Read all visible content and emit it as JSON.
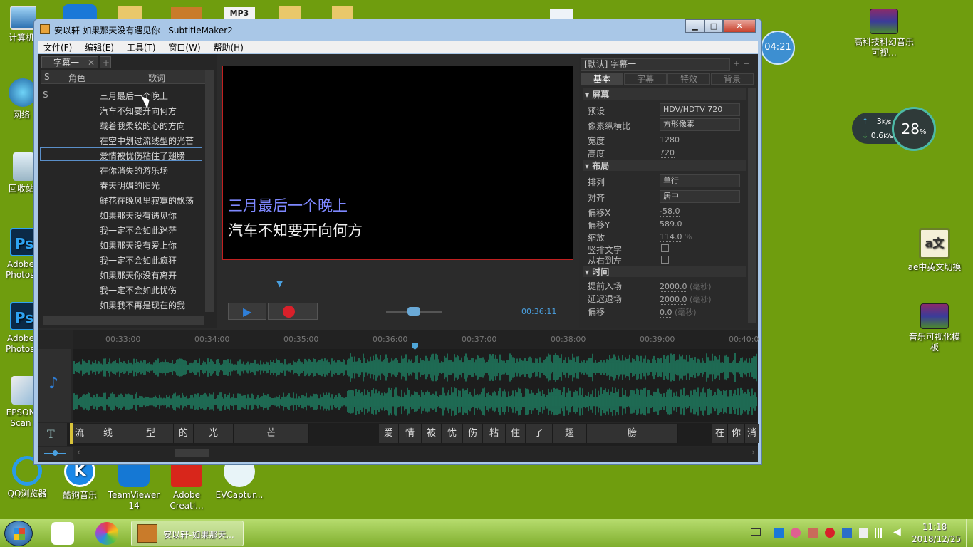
{
  "desktop": {
    "icons": [
      {
        "label": "计算机"
      },
      {
        "label": "网络"
      },
      {
        "label": "回收站"
      },
      {
        "label": "Adobe Photoshop"
      },
      {
        "label": "Adobe Photoshop"
      },
      {
        "label": "EPSON Scan"
      },
      {
        "label": "QQ浏览器"
      },
      {
        "label": "酷狗音乐"
      },
      {
        "label": "TeamViewer 14"
      },
      {
        "label": "Adobe Creati..."
      },
      {
        "label": "EVCaptur..."
      },
      {
        "label": "高科技科幻音乐可视..."
      },
      {
        "label": "ae中英文切换"
      },
      {
        "label": "音乐可视化模板"
      }
    ],
    "top_badge": "MP3"
  },
  "widgets": {
    "clock": "04:21",
    "net_up": "3",
    "net_up_unit": "K/s",
    "net_down": "0.6",
    "net_down_unit": "K/s",
    "cpu_percent": "28",
    "cpu_unit": "%"
  },
  "window": {
    "title": "安以轩-如果那天没有遇见你 - SubtitleMaker2",
    "menu": [
      "文件(F)",
      "编辑(E)",
      "工具(T)",
      "窗口(W)",
      "帮助(H)"
    ],
    "doc_tab": "字幕一",
    "list_headers": {
      "s": "S",
      "role": "角色",
      "lyrics": "歌词"
    },
    "first_row_s": "S",
    "lyrics": [
      "三月最后一个晚上",
      "汽车不知要开向何方",
      "载着我柔软的心的方向",
      "在空中划过流线型的光芒",
      "爱情被忧伤粘住了翅膀",
      "在你消失的游乐场",
      "春天明媚的阳光",
      "鲜花在晚风里寂寞的飘荡",
      "如果那天没有遇见你",
      "我一定不会如此迷茫",
      "如果那天没有爱上你",
      "我一定不会如此疯狂",
      "如果那天你没有离开",
      "我一定不会如此忧伤",
      "如果我不再是现在的我"
    ],
    "selected_index": 4,
    "preview": {
      "line1": "三月最后一个晚上",
      "line2": "汽车不知要开向何方"
    },
    "timecode": "00:36:11",
    "props": {
      "style_select": "[默认] 字幕一",
      "tabs": [
        "基本",
        "字幕",
        "特效",
        "背景"
      ],
      "active_tab": "基本",
      "sec_screen": "屏幕",
      "preset_label": "预设",
      "preset_value": "HDV/HDTV 720",
      "aspect_label": "像素纵横比",
      "aspect_value": "方形像素",
      "width_label": "宽度",
      "width_value": "1280",
      "height_label": "高度",
      "height_value": "720",
      "sec_layout": "布局",
      "arrange_label": "排列",
      "arrange_value": "单行",
      "align_label": "对齐",
      "align_value": "居中",
      "offx_label": "偏移X",
      "offx_value": "-58.0",
      "offy_label": "偏移Y",
      "offy_value": "589.0",
      "scale_label": "缩放",
      "scale_value": "114.0",
      "scale_unit": "%",
      "vertical_label": "竖排文字",
      "rtl_label": "从右到左",
      "sec_time": "时间",
      "lead_in_label": "提前入场",
      "lead_in_value": "2000.0",
      "ms1": "(毫秒)",
      "delay_label": "延迟退场",
      "delay_value": "2000.0",
      "ms2": "(毫秒)",
      "offset_label": "偏移",
      "offset_value": "0.0",
      "ms3": "(毫秒)"
    },
    "timeline": {
      "ticks": [
        "00:33:00",
        "00:34:00",
        "00:35:00",
        "00:36:00",
        "00:37:00",
        "00:38:00",
        "00:39:00",
        "00:40:0"
      ],
      "chars_a": [
        "流",
        "线",
        "型",
        "的",
        "光",
        "芒"
      ],
      "chars_b": [
        "爱",
        "情",
        "被",
        "忧",
        "伤",
        "粘",
        "住",
        "了",
        "翅",
        "膀"
      ],
      "chars_c": [
        "在",
        "你",
        "消"
      ]
    }
  },
  "taskbar": {
    "task_label": "安以轩-如果那天...",
    "time": "11:18",
    "date": "2018/12/25"
  }
}
